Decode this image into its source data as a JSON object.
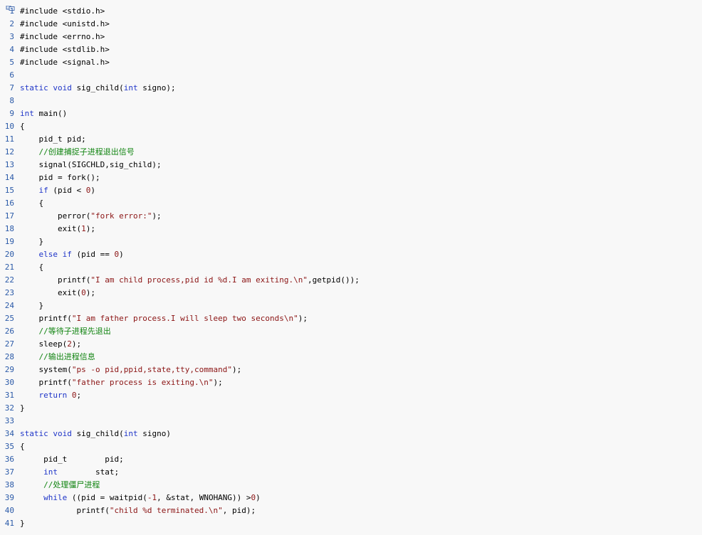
{
  "colors": {
    "background": "#f8f8f8",
    "line_number": "#2b5aa8",
    "keyword": "#1f35c8",
    "string": "#8b1414",
    "number": "#8b1414",
    "comment": "#118411",
    "text": "#000000"
  },
  "header": {
    "icon": "copy-to-clipboard-icon"
  },
  "code": {
    "lines": [
      {
        "n": "1",
        "tokens": [
          {
            "t": "plain",
            "v": "#include <stdio.h>"
          }
        ]
      },
      {
        "n": "2",
        "tokens": [
          {
            "t": "plain",
            "v": "#include <unistd.h>"
          }
        ]
      },
      {
        "n": "3",
        "tokens": [
          {
            "t": "plain",
            "v": "#include <errno.h>"
          }
        ]
      },
      {
        "n": "4",
        "tokens": [
          {
            "t": "plain",
            "v": "#include <stdlib.h>"
          }
        ]
      },
      {
        "n": "5",
        "tokens": [
          {
            "t": "plain",
            "v": "#include <signal.h>"
          }
        ]
      },
      {
        "n": "6",
        "tokens": []
      },
      {
        "n": "7",
        "tokens": [
          {
            "t": "kw",
            "v": "static"
          },
          {
            "t": "plain",
            "v": " "
          },
          {
            "t": "kw",
            "v": "void"
          },
          {
            "t": "plain",
            "v": " sig_child("
          },
          {
            "t": "kw",
            "v": "int"
          },
          {
            "t": "plain",
            "v": " signo);"
          }
        ]
      },
      {
        "n": "8",
        "tokens": []
      },
      {
        "n": "9",
        "tokens": [
          {
            "t": "kw",
            "v": "int"
          },
          {
            "t": "plain",
            "v": " main()"
          }
        ]
      },
      {
        "n": "10",
        "tokens": [
          {
            "t": "plain",
            "v": "{"
          }
        ]
      },
      {
        "n": "11",
        "tokens": [
          {
            "t": "plain",
            "v": "    pid_t pid;"
          }
        ]
      },
      {
        "n": "12",
        "tokens": [
          {
            "t": "plain",
            "v": "    "
          },
          {
            "t": "cmt",
            "v": "//创建捕捉子进程退出信号"
          }
        ]
      },
      {
        "n": "13",
        "tokens": [
          {
            "t": "plain",
            "v": "    signal(SIGCHLD,sig_child);"
          }
        ]
      },
      {
        "n": "14",
        "tokens": [
          {
            "t": "plain",
            "v": "    pid = fork();"
          }
        ]
      },
      {
        "n": "15",
        "tokens": [
          {
            "t": "plain",
            "v": "    "
          },
          {
            "t": "kw",
            "v": "if"
          },
          {
            "t": "plain",
            "v": " (pid < "
          },
          {
            "t": "num",
            "v": "0"
          },
          {
            "t": "plain",
            "v": ")"
          }
        ]
      },
      {
        "n": "16",
        "tokens": [
          {
            "t": "plain",
            "v": "    {"
          }
        ]
      },
      {
        "n": "17",
        "tokens": [
          {
            "t": "plain",
            "v": "        perror("
          },
          {
            "t": "str",
            "v": "\"fork error:\""
          },
          {
            "t": "plain",
            "v": ");"
          }
        ]
      },
      {
        "n": "18",
        "tokens": [
          {
            "t": "plain",
            "v": "        exit("
          },
          {
            "t": "num",
            "v": "1"
          },
          {
            "t": "plain",
            "v": ");"
          }
        ]
      },
      {
        "n": "19",
        "tokens": [
          {
            "t": "plain",
            "v": "    }"
          }
        ]
      },
      {
        "n": "20",
        "tokens": [
          {
            "t": "plain",
            "v": "    "
          },
          {
            "t": "kw",
            "v": "else"
          },
          {
            "t": "plain",
            "v": " "
          },
          {
            "t": "kw",
            "v": "if"
          },
          {
            "t": "plain",
            "v": " (pid == "
          },
          {
            "t": "num",
            "v": "0"
          },
          {
            "t": "plain",
            "v": ")"
          }
        ]
      },
      {
        "n": "21",
        "tokens": [
          {
            "t": "plain",
            "v": "    {"
          }
        ]
      },
      {
        "n": "22",
        "tokens": [
          {
            "t": "plain",
            "v": "        printf("
          },
          {
            "t": "str",
            "v": "\"I am child process,pid id %d.I am exiting.\\n\""
          },
          {
            "t": "plain",
            "v": ",getpid());"
          }
        ]
      },
      {
        "n": "23",
        "tokens": [
          {
            "t": "plain",
            "v": "        exit("
          },
          {
            "t": "num",
            "v": "0"
          },
          {
            "t": "plain",
            "v": ");"
          }
        ]
      },
      {
        "n": "24",
        "tokens": [
          {
            "t": "plain",
            "v": "    }"
          }
        ]
      },
      {
        "n": "25",
        "tokens": [
          {
            "t": "plain",
            "v": "    printf("
          },
          {
            "t": "str",
            "v": "\"I am father process.I will sleep two seconds\\n\""
          },
          {
            "t": "plain",
            "v": ");"
          }
        ]
      },
      {
        "n": "26",
        "tokens": [
          {
            "t": "plain",
            "v": "    "
          },
          {
            "t": "cmt",
            "v": "//等待子进程先退出"
          }
        ]
      },
      {
        "n": "27",
        "tokens": [
          {
            "t": "plain",
            "v": "    sleep("
          },
          {
            "t": "num",
            "v": "2"
          },
          {
            "t": "plain",
            "v": ");"
          }
        ]
      },
      {
        "n": "28",
        "tokens": [
          {
            "t": "plain",
            "v": "    "
          },
          {
            "t": "cmt",
            "v": "//输出进程信息"
          }
        ]
      },
      {
        "n": "29",
        "tokens": [
          {
            "t": "plain",
            "v": "    system("
          },
          {
            "t": "str",
            "v": "\"ps -o pid,ppid,state,tty,command\""
          },
          {
            "t": "plain",
            "v": ");"
          }
        ]
      },
      {
        "n": "30",
        "tokens": [
          {
            "t": "plain",
            "v": "    printf("
          },
          {
            "t": "str",
            "v": "\"father process is exiting.\\n\""
          },
          {
            "t": "plain",
            "v": ");"
          }
        ]
      },
      {
        "n": "31",
        "tokens": [
          {
            "t": "plain",
            "v": "    "
          },
          {
            "t": "kw",
            "v": "return"
          },
          {
            "t": "plain",
            "v": " "
          },
          {
            "t": "num",
            "v": "0"
          },
          {
            "t": "plain",
            "v": ";"
          }
        ]
      },
      {
        "n": "32",
        "tokens": [
          {
            "t": "plain",
            "v": "}"
          }
        ]
      },
      {
        "n": "33",
        "tokens": []
      },
      {
        "n": "34",
        "tokens": [
          {
            "t": "kw",
            "v": "static"
          },
          {
            "t": "plain",
            "v": " "
          },
          {
            "t": "kw",
            "v": "void"
          },
          {
            "t": "plain",
            "v": " sig_child("
          },
          {
            "t": "kw",
            "v": "int"
          },
          {
            "t": "plain",
            "v": " signo)"
          }
        ]
      },
      {
        "n": "35",
        "tokens": [
          {
            "t": "plain",
            "v": "{"
          }
        ]
      },
      {
        "n": "36",
        "tokens": [
          {
            "t": "plain",
            "v": "     pid_t        pid;"
          }
        ]
      },
      {
        "n": "37",
        "tokens": [
          {
            "t": "plain",
            "v": "     "
          },
          {
            "t": "kw",
            "v": "int"
          },
          {
            "t": "plain",
            "v": "        stat;"
          }
        ]
      },
      {
        "n": "38",
        "tokens": [
          {
            "t": "plain",
            "v": "     "
          },
          {
            "t": "cmt",
            "v": "//处理僵尸进程"
          }
        ]
      },
      {
        "n": "39",
        "tokens": [
          {
            "t": "plain",
            "v": "     "
          },
          {
            "t": "kw",
            "v": "while"
          },
          {
            "t": "plain",
            "v": " ((pid = waitpid("
          },
          {
            "t": "num",
            "v": "-1"
          },
          {
            "t": "plain",
            "v": ", &stat, WNOHANG)) >"
          },
          {
            "t": "num",
            "v": "0"
          },
          {
            "t": "plain",
            "v": ")"
          }
        ]
      },
      {
        "n": "40",
        "tokens": [
          {
            "t": "plain",
            "v": "            printf("
          },
          {
            "t": "str",
            "v": "\"child %d terminated.\\n\""
          },
          {
            "t": "plain",
            "v": ", pid);"
          }
        ]
      },
      {
        "n": "41",
        "tokens": [
          {
            "t": "plain",
            "v": "}"
          }
        ]
      }
    ]
  }
}
